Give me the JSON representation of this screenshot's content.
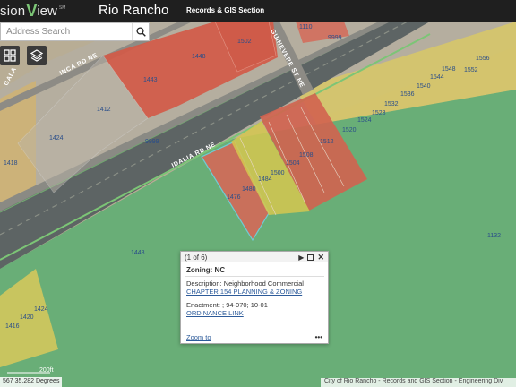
{
  "app": {
    "logo_prefix": "sion",
    "logo_v": "V",
    "logo_suffix": "iew",
    "logo_mark": "SM",
    "city": "Rio Rancho",
    "section": "Records & GIS Section"
  },
  "search": {
    "placeholder": "Address Search"
  },
  "tools": {
    "grid_icon": "grid-icon",
    "layers_icon": "layers-icon"
  },
  "roads": {
    "idalia": "IDALIA RD NE",
    "inca": "INCA RD NE",
    "guinevere": "GUINEVERE ST NE",
    "gala": "GALA"
  },
  "parcels": [
    "1502",
    "1448",
    "1443",
    "1412",
    "1424",
    "1418",
    "9999",
    "9999",
    "1110",
    "1476",
    "1480",
    "1484",
    "1500",
    "1504",
    "1508",
    "1512",
    "1520",
    "1524",
    "1528",
    "1532",
    "1536",
    "1540",
    "1544",
    "1548",
    "1552",
    "1556",
    "1132",
    "1448",
    "1424",
    "1420",
    "1416"
  ],
  "colors": {
    "commercial": "#d96a55",
    "residential": "#e0d060",
    "open_space": "#6fb27a",
    "vacant": "#b9b2a5",
    "highway": "#555b5c",
    "parcel_outline": "#6fd0e0"
  },
  "popup": {
    "counter": "(1 of 6)",
    "title": "Zoning: NC",
    "description_label": "Description:",
    "description_value": "Neighborhood Commercial",
    "chapter_link": "CHAPTER 154 PLANNING & ZONING",
    "enactment_label": "Enactment:",
    "enactment_value": "; 94-070; 10-01",
    "ordinance_link": "ORDINANCE LINK",
    "zoom_to": "Zoom to",
    "more": "•••"
  },
  "status": {
    "coordinates": "567 35.282 Degrees",
    "scale_label": "200ft",
    "attribution": "City of Rio Rancho - Records and GIS Section - Engineering Div"
  }
}
